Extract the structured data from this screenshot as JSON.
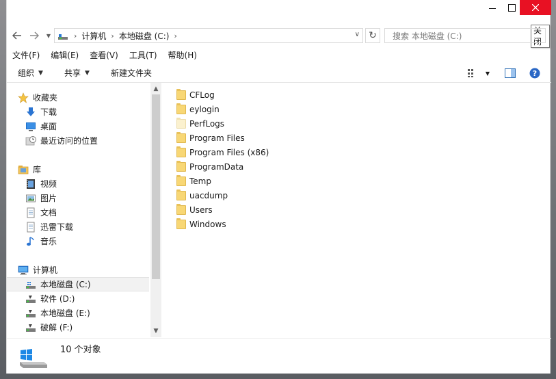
{
  "window": {
    "close_tooltip": "关闭"
  },
  "address": {
    "crumbs": [
      "计算机",
      "本地磁盘 (C:)"
    ],
    "search_placeholder": "搜索 本地磁盘 (C:)"
  },
  "menu": [
    "文件(F)",
    "编辑(E)",
    "查看(V)",
    "工具(T)",
    "帮助(H)"
  ],
  "toolbar": {
    "organize": "组织",
    "share": "共享",
    "new_folder": "新建文件夹"
  },
  "nav": {
    "favorites": {
      "label": "收藏夹",
      "items": [
        "下载",
        "桌面",
        "最近访问的位置"
      ]
    },
    "libraries": {
      "label": "库",
      "items": [
        "视频",
        "图片",
        "文档",
        "迅雷下载",
        "音乐"
      ]
    },
    "computer": {
      "label": "计算机",
      "items": [
        "本地磁盘 (C:)",
        "软件 (D:)",
        "本地磁盘 (E:)",
        "破解 (F:)"
      ]
    }
  },
  "files": [
    "CFLog",
    "eylogin",
    "PerfLogs",
    "Program Files",
    "Program Files (x86)",
    "ProgramData",
    "Temp",
    "uacdump",
    "Users",
    "Windows"
  ],
  "status": {
    "count_text": "10 个对象"
  },
  "colors": {
    "close_button": "#e81123",
    "folder": "#f8d775",
    "selection": "#f2f2f2"
  }
}
